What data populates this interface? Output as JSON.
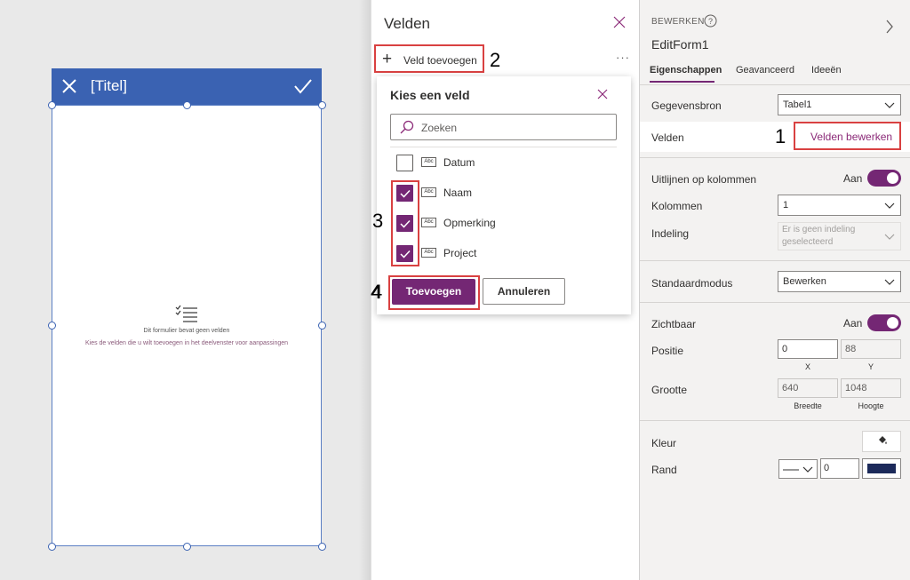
{
  "form": {
    "title": "[Titel]",
    "empty_line1": "Dit formulier bevat geen velden",
    "empty_line2": "Kies de velden die u wilt toevoegen in het deelvenster voor aanpassingen"
  },
  "velden_panel": {
    "title": "Velden",
    "add_field_label": "Veld toevoegen",
    "more_label": "···"
  },
  "popup": {
    "title": "Kies een veld",
    "search_placeholder": "Zoeken",
    "icon_text": "Abc",
    "fields": [
      {
        "name": "Datum",
        "checked": false
      },
      {
        "name": "Naam",
        "checked": true
      },
      {
        "name": "Opmerking",
        "checked": true
      },
      {
        "name": "Project",
        "checked": true
      }
    ],
    "add_label": "Toevoegen",
    "cancel_label": "Annuleren"
  },
  "steps": [
    "1",
    "2",
    "3",
    "4"
  ],
  "properties": {
    "eyebrow": "BEWERKEN",
    "control_name": "EditForm1",
    "tabs": [
      "Eigenschappen",
      "Geavanceerd",
      "Ideeën"
    ],
    "gegevensbron_label": "Gegevensbron",
    "gegevensbron_value": "Tabel1",
    "velden_label": "Velden",
    "velden_edit_label": "Velden bewerken",
    "uitlijnen_label": "Uitlijnen op kolommen",
    "uitlijnen_value": "Aan",
    "kolommen_label": "Kolommen",
    "kolommen_value": "1",
    "indeling_label": "Indeling",
    "indeling_value": "Er is geen indeling geselecteerd",
    "standaardmodus_label": "Standaardmodus",
    "standaardmodus_value": "Bewerken",
    "zichtbaar_label": "Zichtbaar",
    "zichtbaar_value": "Aan",
    "positie_label": "Positie",
    "pos_x": "0",
    "pos_y": "88",
    "x_label": "X",
    "y_label": "Y",
    "grootte_label": "Grootte",
    "breedte": "640",
    "hoogte": "1048",
    "breedte_label": "Breedte",
    "hoogte_label": "Hoogte",
    "kleur_label": "Kleur",
    "rand_label": "Rand",
    "rand_width": "0",
    "rand_color": "#1c2a5a"
  },
  "colors": {
    "accent": "#742774",
    "form_header": "#3a62b2",
    "highlight": "#d94141"
  }
}
